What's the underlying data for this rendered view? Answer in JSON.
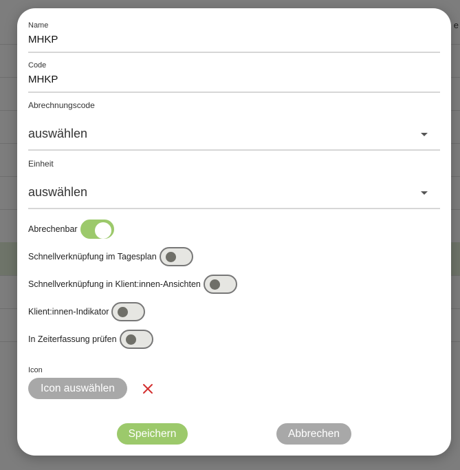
{
  "background": {
    "edge_text": "e"
  },
  "form": {
    "name": {
      "label": "Name",
      "value": "MHKP"
    },
    "code": {
      "label": "Code",
      "value": "MHKP"
    },
    "billing_code": {
      "label": "Abrechnungscode",
      "value": "auswählen"
    },
    "unit": {
      "label": "Einheit",
      "value": "auswählen"
    },
    "toggles": [
      {
        "label": "Abrechenbar",
        "on": true
      },
      {
        "label": "Schnellverknüpfung im Tagesplan",
        "on": false
      },
      {
        "label": "Schnellverknüpfung in Klient:innen-Ansichten",
        "on": false
      },
      {
        "label": "Klient:innen-Indikator",
        "on": false
      },
      {
        "label": "In Zeiterfassung prüfen",
        "on": false
      }
    ],
    "icon": {
      "label": "Icon",
      "select_label": "Icon auswählen"
    }
  },
  "actions": {
    "save_label": "Speichern",
    "cancel_label": "Abbrechen"
  },
  "colors": {
    "accent": "#9cc96b",
    "neutral_button": "#a8a8a8",
    "danger": "#d32f2f"
  }
}
